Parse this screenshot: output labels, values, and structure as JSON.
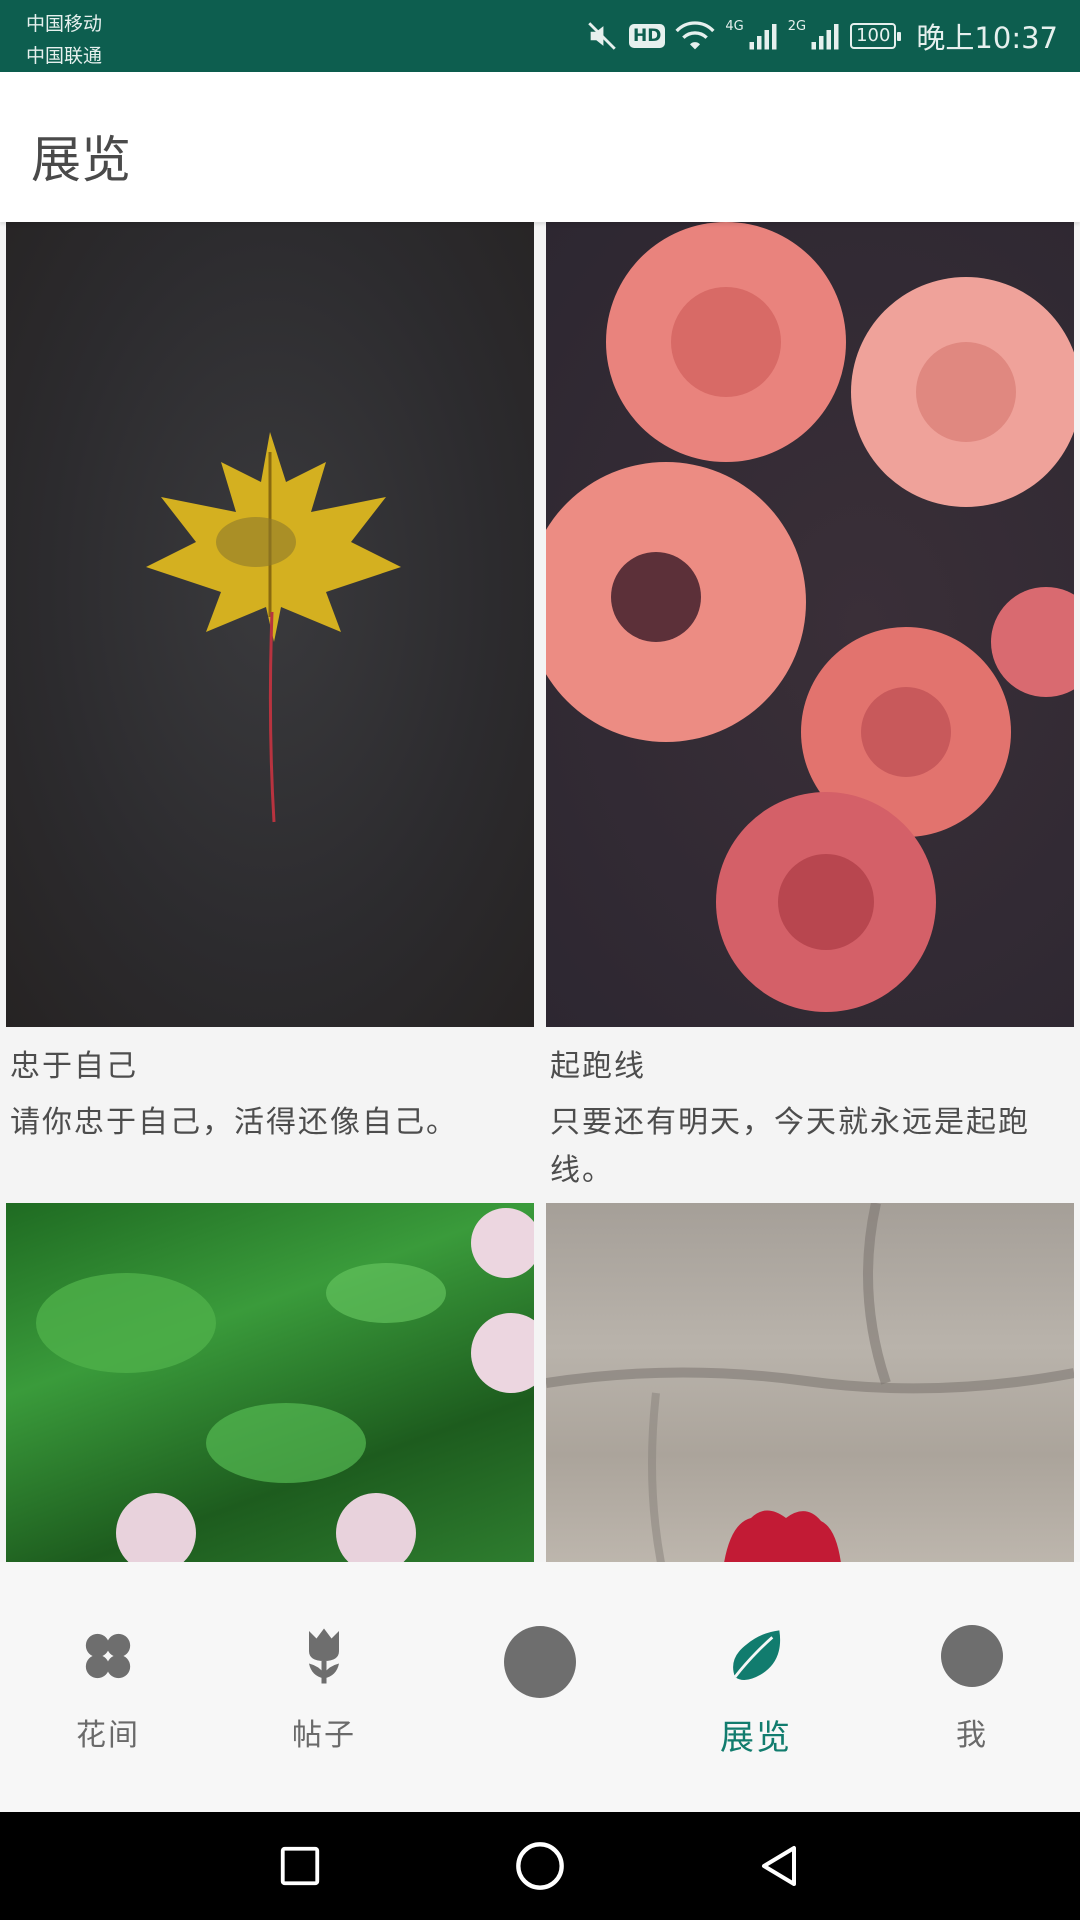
{
  "status_bar": {
    "carrier_1": "中国移动",
    "carrier_2": "中国联通",
    "hd_badge": "HD",
    "network_1": "4G",
    "network_2": "2G",
    "battery": "100",
    "time": "晚上10:37"
  },
  "app_bar": {
    "title": "展览"
  },
  "cards": [
    {
      "title": "忠于自己",
      "text": "请你忠于自己，活得还像自己。",
      "image": "yellow-maple-leaf-photo"
    },
    {
      "title": "起跑线",
      "text": "只要还有明天，今天就永远是起跑线。",
      "image": "pink-roses-photo"
    },
    {
      "title": "",
      "text": "",
      "image": "green-leaves-pink-flowers-photo"
    },
    {
      "title": "",
      "text": "",
      "image": "red-flower-stone-wall-photo"
    }
  ],
  "bottom_nav": {
    "items": [
      {
        "label": "花间",
        "icon": "clover-icon",
        "active": false
      },
      {
        "label": "帖子",
        "icon": "tulip-icon",
        "active": false
      },
      {
        "label": "",
        "icon": "center-circle-button",
        "active": false
      },
      {
        "label": "展览",
        "icon": "leaf-icon",
        "active": true
      },
      {
        "label": "我",
        "icon": "profile-circle-icon",
        "active": false
      }
    ],
    "active_color": "#117c6e",
    "inactive_color": "#6a6a6a"
  },
  "system_nav": {
    "buttons": [
      "recent-apps-icon",
      "home-icon",
      "back-icon"
    ]
  },
  "colors": {
    "status_bar": "#0d5e4f",
    "accent": "#117c6e"
  }
}
